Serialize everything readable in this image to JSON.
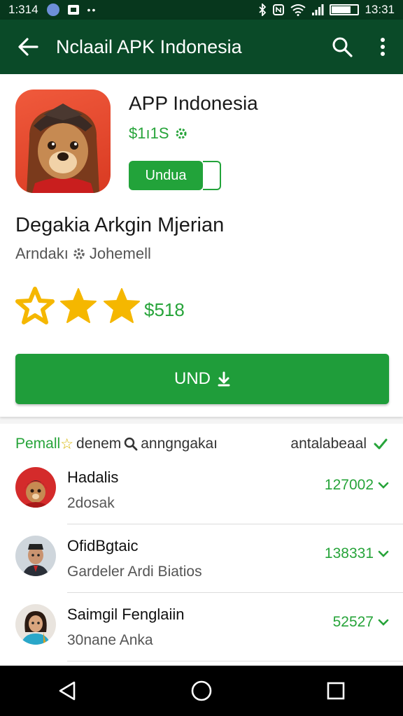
{
  "status_bar": {
    "time_left": "1:314",
    "time_right": "13:31",
    "left_icons": [
      "globe-icon",
      "image-icon",
      "more-dots-icon"
    ],
    "right_icons": [
      "bluetooth-icon",
      "nfc-icon",
      "wifi-icon",
      "signal-icon",
      "battery-icon"
    ],
    "battery_level": 0.7
  },
  "app_bar": {
    "title": "Nclaail APK Indonesia",
    "back_icon": "arrow-back-icon",
    "search_icon": "search-icon",
    "menu_icon": "more-vert-icon"
  },
  "app": {
    "name": "APP Indonesia",
    "price": "$1ı1S",
    "install_label": "Undua",
    "headline": "Degakia Arkgin Mjerian",
    "developer": "Arndakı",
    "developer_suffix": "Johemell",
    "rating_stars": 3,
    "rating_price": "$518",
    "download_label": "UND"
  },
  "section": {
    "title_left": "Pemall",
    "title_mid": "denem",
    "search_text": "anngngakaı",
    "title_right": "antalabeaal"
  },
  "reviews": [
    {
      "name": "Hadalis",
      "sub": "2dosak",
      "count": "127002"
    },
    {
      "name": "OfidBgtaic",
      "sub": "Gardeler Ardi Biatios",
      "count": "138331"
    },
    {
      "name": "Saimgil Fenglaiin",
      "sub": "30nane Anka",
      "count": "52527"
    }
  ],
  "colors": {
    "accent_green": "#22a33a",
    "app_bar": "#0a4a28",
    "status_bar": "#07371d",
    "star": "#f5b700"
  }
}
